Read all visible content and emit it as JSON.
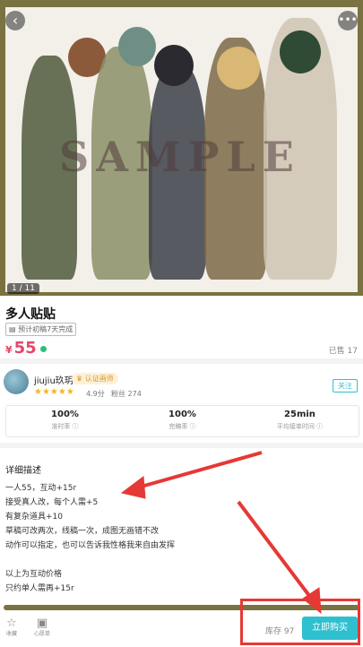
{
  "hero": {
    "watermark": "SAMPLE",
    "pager": "1 / 11"
  },
  "product": {
    "title": "多人贴贴",
    "tag": "预计初稿7天完成",
    "price_currency": "¥",
    "price_value": "55",
    "sold_text": "已售 17"
  },
  "seller": {
    "name": "jiujiu玖玥",
    "badge": "认证画师",
    "stars": "★★★★★",
    "rating": "4.9分",
    "fans": "粉丝 274",
    "follow": "关注"
  },
  "stats": [
    {
      "value": "100%",
      "label": "准时率 ⓘ"
    },
    {
      "value": "100%",
      "label": "完稿率 ⓘ"
    },
    {
      "value": "25min",
      "label": "平均接单时间 ⓘ"
    }
  ],
  "description": {
    "title": "详细描述",
    "lines_a": [
      "一人55，互动+15r",
      "接受真人改，每个人需+5",
      "有复杂道具+10",
      "草稿可改两次，线稿一次，成图无画错不改",
      "动作可以指定，也可以告诉我性格我来自由发挥"
    ],
    "lines_b": [
      "以上为互动价格",
      "只约单人需再+15r"
    ]
  },
  "toolbar": {
    "favorite": "收藏",
    "orders": "心愿单",
    "stock": "库存 97",
    "buy": "立即购买"
  },
  "colors": {
    "accent": "#2fc0cf",
    "price": "#e8466b",
    "annotation": "#e53935",
    "frame": "#7a7240"
  }
}
